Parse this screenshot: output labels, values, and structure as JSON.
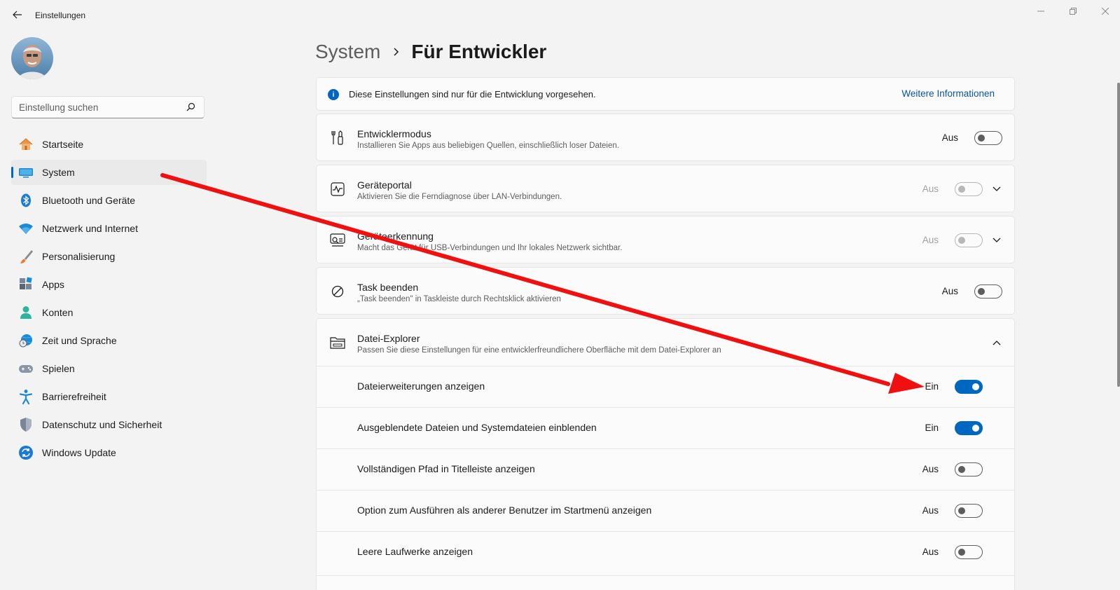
{
  "window": {
    "title": "Einstellungen"
  },
  "search": {
    "placeholder": "Einstellung suchen"
  },
  "sidebar": {
    "items": [
      {
        "label": "Startseite"
      },
      {
        "label": "System"
      },
      {
        "label": "Bluetooth und Geräte"
      },
      {
        "label": "Netzwerk und Internet"
      },
      {
        "label": "Personalisierung"
      },
      {
        "label": "Apps"
      },
      {
        "label": "Konten"
      },
      {
        "label": "Zeit und Sprache"
      },
      {
        "label": "Spielen"
      },
      {
        "label": "Barrierefreiheit"
      },
      {
        "label": "Datenschutz und Sicherheit"
      },
      {
        "label": "Windows Update"
      }
    ],
    "active_index": 1
  },
  "breadcrumb": {
    "parent": "System",
    "current": "Für Entwickler"
  },
  "info": {
    "text": "Diese Einstellungen sind nur für die Entwicklung vorgesehen.",
    "link": "Weitere Informationen"
  },
  "settings": [
    {
      "title": "Entwicklermodus",
      "desc": "Installieren Sie Apps aus beliebigen Quellen, einschließlich loser Dateien.",
      "state": "Aus",
      "on": false,
      "enabled": true
    },
    {
      "title": "Geräteportal",
      "desc": "Aktivieren Sie die Ferndiagnose über LAN-Verbindungen.",
      "state": "Aus",
      "on": false,
      "enabled": false
    },
    {
      "title": "Geräteerkennung",
      "desc": "Macht das Gerät für USB-Verbindungen und Ihr lokales Netzwerk sichtbar.",
      "state": "Aus",
      "on": false,
      "enabled": false
    },
    {
      "title": "Task beenden",
      "desc": "„Task beenden\" in Taskleiste durch Rechtsklick aktivieren",
      "state": "Aus",
      "on": false,
      "enabled": true
    }
  ],
  "explorer": {
    "title": "Datei-Explorer",
    "desc": "Passen Sie diese Einstellungen für eine entwicklerfreundlichere Oberfläche mit dem Datei-Explorer an",
    "options": [
      {
        "label": "Dateierweiterungen anzeigen",
        "state": "Ein",
        "on": true
      },
      {
        "label": "Ausgeblendete Dateien und Systemdateien einblenden",
        "state": "Ein",
        "on": true
      },
      {
        "label": "Vollständigen Pfad in Titelleiste anzeigen",
        "state": "Aus",
        "on": false
      },
      {
        "label": "Option zum Ausführen als anderer Benutzer im Startmenü anzeigen",
        "state": "Aus",
        "on": false
      },
      {
        "label": "Leere Laufwerke anzeigen",
        "state": "Aus",
        "on": false
      }
    ]
  },
  "colors": {
    "accent": "#0067c0",
    "annotation_arrow": "#f01010"
  }
}
